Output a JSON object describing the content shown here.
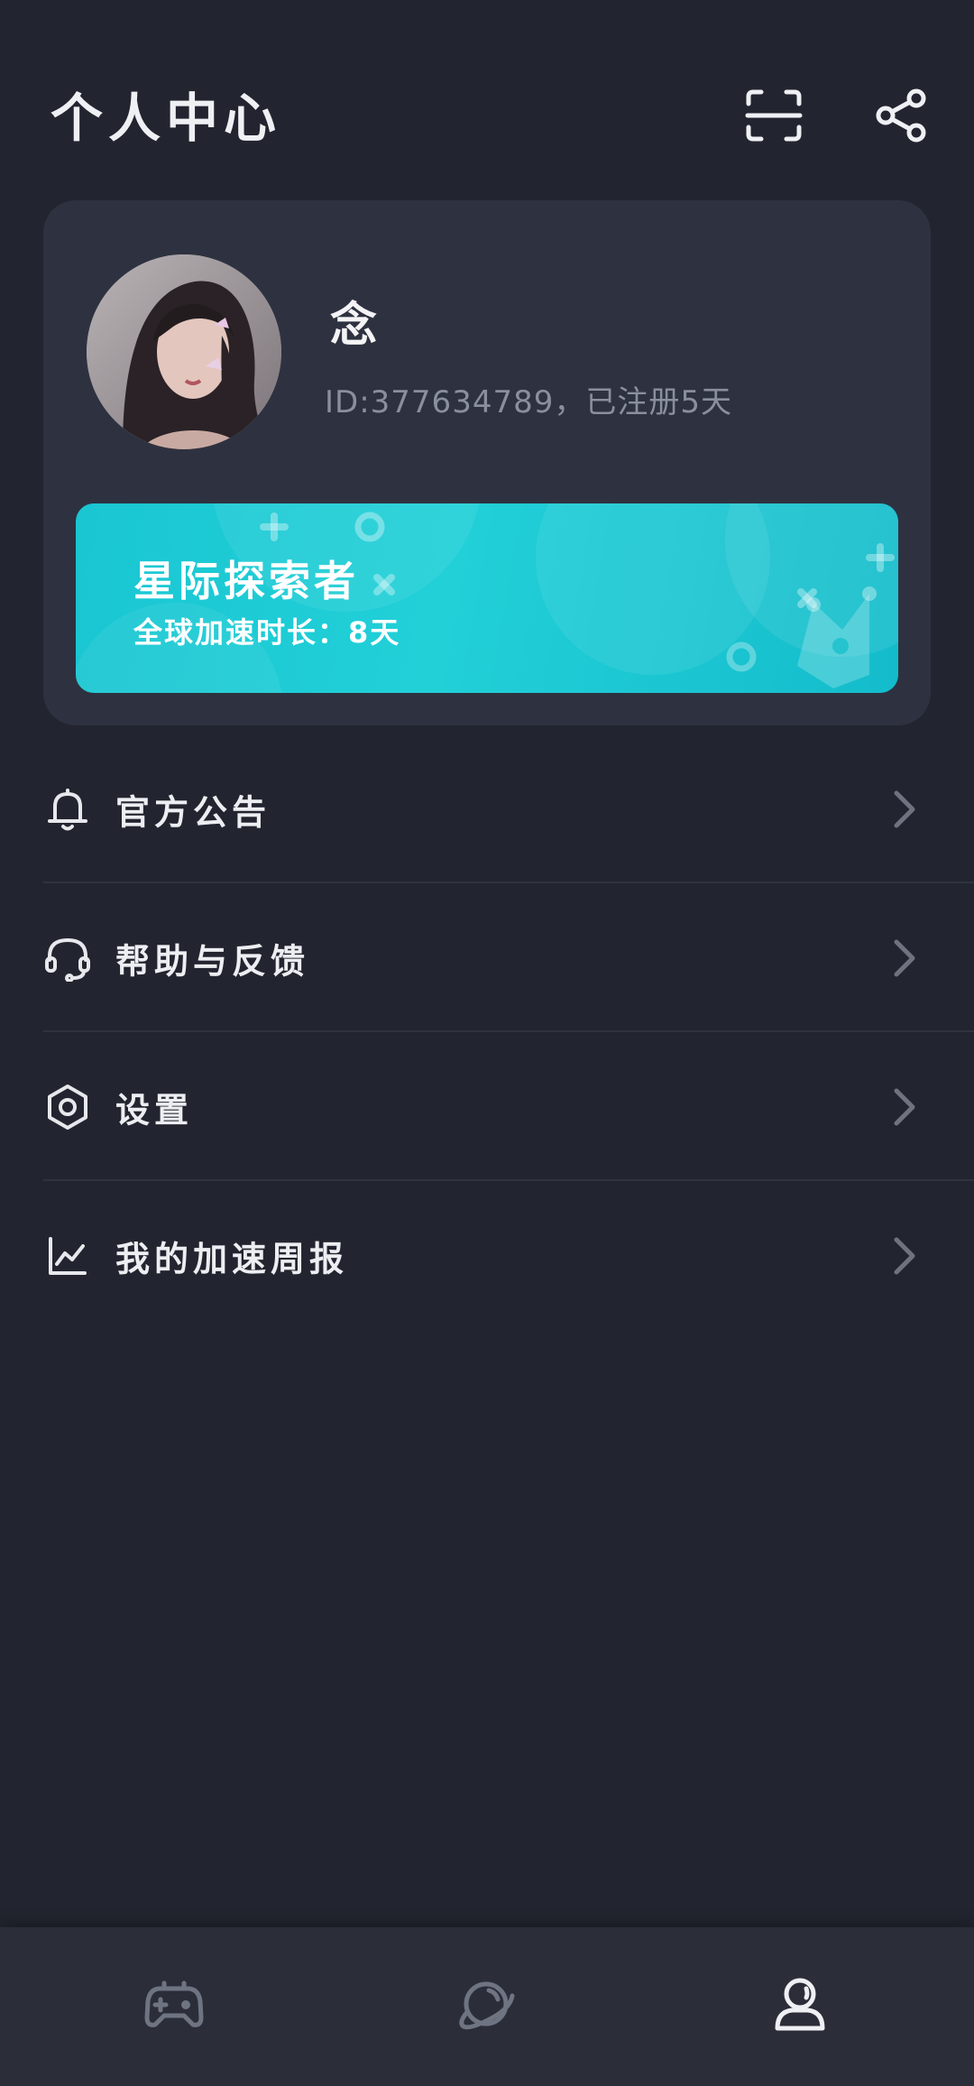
{
  "header": {
    "title": "个人中心",
    "scan_icon": "scan-icon",
    "share_icon": "share-icon"
  },
  "profile": {
    "name": "念",
    "id_line": "ID:377634789，已注册5天",
    "avatar": "user-avatar"
  },
  "vip": {
    "title": "星际探索者",
    "subtitle": "全球加速时长：8天"
  },
  "menu": {
    "items": [
      {
        "label": "官方公告",
        "icon": "bell-icon"
      },
      {
        "label": "帮助与反馈",
        "icon": "headset-icon"
      },
      {
        "label": "设置",
        "icon": "settings-icon"
      },
      {
        "label": "我的加速周报",
        "icon": "chart-icon"
      }
    ]
  },
  "tabbar": {
    "tabs": [
      {
        "icon": "gamepad-icon",
        "active": false
      },
      {
        "icon": "planet-icon",
        "active": false
      },
      {
        "icon": "profile-icon",
        "active": true
      }
    ]
  },
  "colors": {
    "background": "#22252f",
    "card": "#2e3240",
    "accent": "#1fcad4",
    "text_primary": "#eef0f4",
    "text_secondary": "#8a8f9d"
  }
}
